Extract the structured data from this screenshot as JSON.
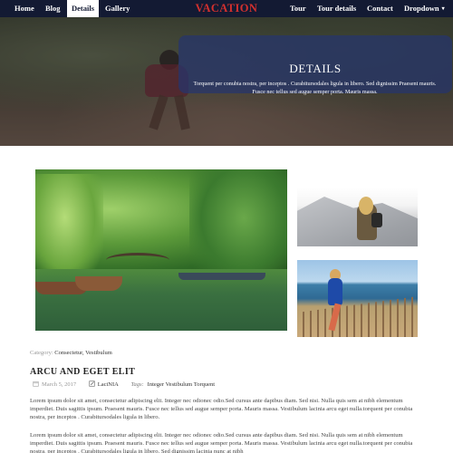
{
  "navbar": {
    "links_left": [
      {
        "label": "Home",
        "active": false
      },
      {
        "label": "Blog",
        "active": false
      },
      {
        "label": "Details",
        "active": true
      },
      {
        "label": "Gallery",
        "active": false
      }
    ],
    "brand": "VACATION",
    "links_right": [
      {
        "label": "Tour"
      },
      {
        "label": "Tour details"
      },
      {
        "label": "Contact"
      },
      {
        "label": "Dropdown"
      }
    ],
    "colors": {
      "background": "#131a33",
      "brand": "#d3302e",
      "active_bg": "#ffffff"
    }
  },
  "hero": {
    "title": "DETAILS",
    "text": "Torquent per conubia nostra, per inceptos . Curabitursodales ligula in libero. Sed dignissim Praesent mauris. Fusce nec tellus sed augue semper porta. Mauris massa.",
    "overlay_color": "#26346e"
  },
  "gallery": {
    "images": [
      {
        "name": "river-boats-photo"
      },
      {
        "name": "rock-traveler-photo"
      },
      {
        "name": "seaside-girl-photo"
      }
    ]
  },
  "post": {
    "category_label": "Category:",
    "category_tags": "Consectetur, Vestibulum",
    "title": "ARCU AND EGET ELIT",
    "date": "March 5, 2017",
    "author": "LaciNIA",
    "tags_label": "Tags:",
    "tags": "Integer Vestibulum Torquent",
    "paragraphs": [
      "Lorem ipsum dolor sit amet, consectetur adipiscing elit. Integer nec odionec odio.Sed cursus ante dapibus diam. Sed nisi. Nulla quis sem at nibh elementum imperdiet. Duis sagittis ipsum. Praesent mauris. Fusce nec tellus sed augue semper porta. Mauris massa. Vestibulum lacinia arcu eget nulla.torquent per conubia nostra, per inceptos . Curabitursodales ligula in libero.",
      "Lorem ipsum dolor sit amet, consectetur adipiscing elit. Integer nec odionec odio.Sed cursus ante dapibus diam. Sed nisi. Nulla quis sem at nibh elementum imperdiet. Duis sagittis ipsum. Praesent mauris. Fusce nec tellus sed augue semper porta. Mauris massa. Vestibulum lacinia arcu eget nulla.torquent per conubia nostra, per inceptos . Curabitursodales ligula in libero. Sed dignissim lacinia nunc at nibh"
    ]
  }
}
